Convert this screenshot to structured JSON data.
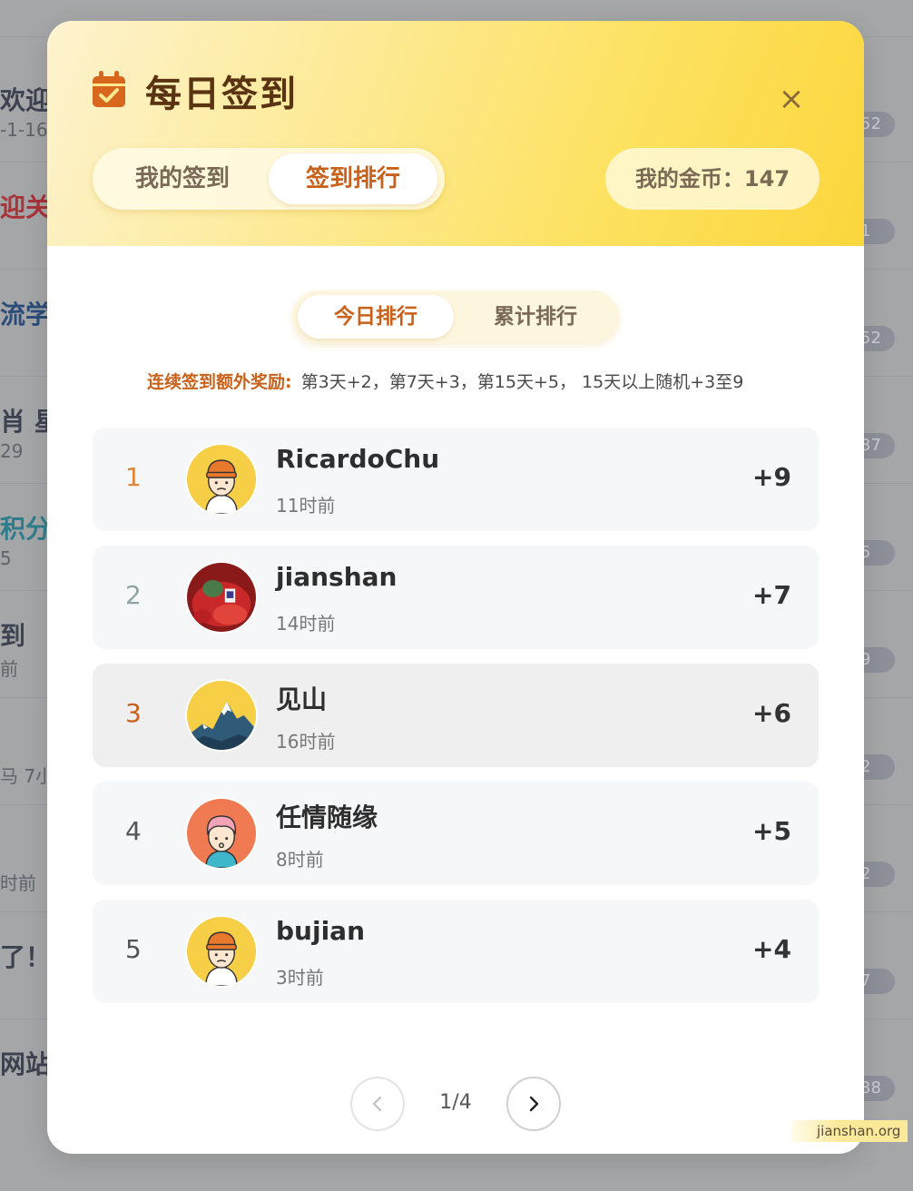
{
  "background": {
    "rows": [
      {
        "title": "欢迎",
        "sub": "-1-16",
        "badge": "52",
        "tone": ""
      },
      {
        "title": "迎关",
        "sub": "",
        "badge": "1",
        "tone": "red"
      },
      {
        "title": "流学",
        "sub": "",
        "badge": "52",
        "tone": "blue"
      },
      {
        "title": "肖 星",
        "sub": "29",
        "badge": "37",
        "tone": ""
      },
      {
        "title": " 积分",
        "sub": "5",
        "badge": "5",
        "tone": "teal"
      },
      {
        "title": "到",
        "sub": "前",
        "badge": "9",
        "tone": ""
      },
      {
        "title": "",
        "sub": "马 7小",
        "badge": "2",
        "tone": ""
      },
      {
        "title": "",
        "sub": "时前",
        "badge": "2",
        "tone": ""
      },
      {
        "title": "了！",
        "sub": "",
        "badge": "7",
        "tone": ""
      },
      {
        "title": "网站",
        "sub": "",
        "badge": "38",
        "tone": ""
      }
    ]
  },
  "modal": {
    "title": "每日签到",
    "close_label": "×",
    "tabs": [
      {
        "label": "我的签到",
        "active": false
      },
      {
        "label": "签到排行",
        "active": true
      }
    ],
    "coins_label": "我的金币：147",
    "sub_tabs": [
      {
        "label": "今日排行",
        "active": true
      },
      {
        "label": "累计排行",
        "active": false
      }
    ],
    "bonus_label": "连续签到额外奖励:",
    "bonus_text": "第3天+2，第7天+3，第15天+5，  15天以上随机+3至9",
    "ranking": [
      {
        "rank": "1",
        "name": "RicardoChu",
        "time": "11时前",
        "points": "+9",
        "avatar": "cartoon-beanie-avatar"
      },
      {
        "rank": "2",
        "name": "jianshan",
        "time": "14时前",
        "points": "+7",
        "avatar": "photo-avatar"
      },
      {
        "rank": "3",
        "name": "见山",
        "time": "16时前",
        "points": "+6",
        "avatar": "mountain-avatar"
      },
      {
        "rank": "4",
        "name": "任情随缘",
        "time": "8时前",
        "points": "+5",
        "avatar": "cartoon-pink-hair-avatar"
      },
      {
        "rank": "5",
        "name": "bujian",
        "time": "3时前",
        "points": "+4",
        "avatar": "cartoon-beanie-avatar"
      }
    ],
    "pagination": {
      "label": "1/4"
    }
  },
  "watermark": "jianshan.org",
  "colors": {
    "accent": "#c9611b",
    "header_gradient_end": "#fbd63c",
    "row_bg": "#f6f7f9"
  }
}
